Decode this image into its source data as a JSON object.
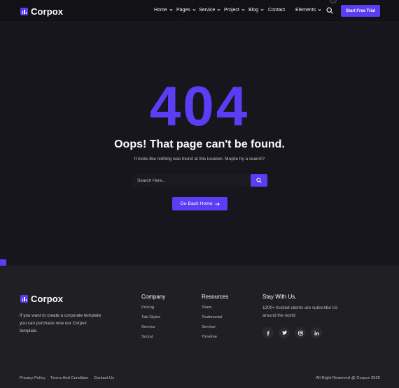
{
  "brand": {
    "name": "Corpox"
  },
  "colors": {
    "accent": "#5a3df5",
    "background": "#17161c",
    "footer": "#1f1f24"
  },
  "nav": {
    "items": [
      {
        "label": "Home",
        "has_dropdown": true
      },
      {
        "label": "Pages",
        "has_dropdown": true
      },
      {
        "label": "Service",
        "has_dropdown": true
      },
      {
        "label": "Project",
        "has_dropdown": true
      },
      {
        "label": "Blog",
        "has_dropdown": true
      },
      {
        "label": "Contact",
        "has_dropdown": false
      },
      {
        "label": "Elements",
        "has_dropdown": true
      }
    ],
    "search_icon": "search-icon",
    "cta_label": "Start Free Trial"
  },
  "hero": {
    "code": "404",
    "title": "Oops! That page can't be found.",
    "subtitle": "It looks like nothing was found at this location. Maybe try a search?",
    "search_placeholder": "Search Here...",
    "back_label": "Go Back Home"
  },
  "footer": {
    "about": "If you want to create a corporate template you can purchace now our Corpex template.",
    "company": {
      "title": "Company",
      "links": [
        "Pricing",
        "Tab Styles",
        "Service",
        "Social"
      ]
    },
    "resources": {
      "title": "Resources",
      "links": [
        "Team",
        "Testimonial",
        "Service",
        "Timeline"
      ]
    },
    "stay": {
      "title": "Stay With Us.",
      "text": "1200+ trusted clients are subscribe Us around the world",
      "socials": [
        "facebook-icon",
        "twitter-icon",
        "instagram-icon",
        "linkedin-icon"
      ]
    },
    "bottom_links": [
      "Privacy Policy",
      "Terms And Condition",
      "Contact Us"
    ],
    "copyright": "All Right Reserved @ Corpox 2025"
  }
}
